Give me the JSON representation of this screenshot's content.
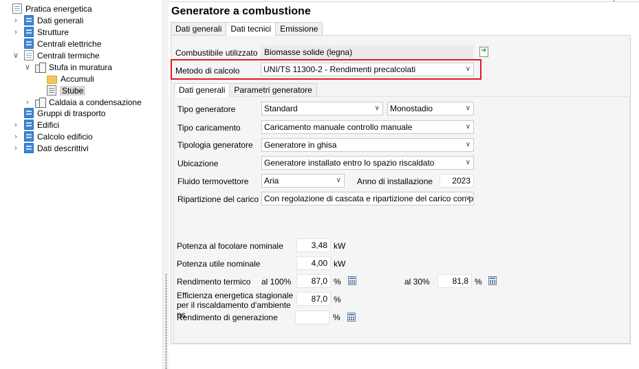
{
  "tree": {
    "items": [
      {
        "label": "Pratica energetica",
        "icon": "document-icon"
      },
      {
        "label": "Dati generali",
        "icon": "blue-sheet-icon"
      },
      {
        "label": "Strutture",
        "icon": "blue-sheet-icon"
      },
      {
        "label": "Centrali elettriche",
        "icon": "blue-sheet-icon"
      },
      {
        "label": "Centrali termiche",
        "icon": "document-icon"
      },
      {
        "label": "Stufa in muratura",
        "icon": "boiler-icon"
      },
      {
        "label": "Accumuli",
        "icon": "folder-icon"
      },
      {
        "label": "Stube",
        "icon": "gray-sheet-icon",
        "selected": true
      },
      {
        "label": "Caldaia a condensazione",
        "icon": "boiler-icon"
      },
      {
        "label": "Gruppi di trasporto",
        "icon": "blue-sheet-icon"
      },
      {
        "label": "Edifici",
        "icon": "blue-sheet-icon"
      },
      {
        "label": "Calcolo edificio",
        "icon": "blue-sheet-icon"
      },
      {
        "label": "Dati descrittivi",
        "icon": "blue-sheet-icon"
      }
    ]
  },
  "main": {
    "title": "Generatore a combustione",
    "tabs": [
      "Dati generali",
      "Dati tecnici",
      "Emissione"
    ],
    "active_tab": "Dati tecnici",
    "combustibile": {
      "label": "Combustibile utilizzato",
      "value": "Biomasse solide (legna)"
    },
    "metodo": {
      "label": "Metodo di calcolo",
      "value": "UNI/TS 11300-2 - Rendimenti precalcolati"
    },
    "subtabs": [
      "Dati generali",
      "Parametri generatore"
    ],
    "active_subtab": "Dati generali",
    "fields": {
      "tipo_generatore": {
        "label": "Tipo generatore",
        "value": "Standard",
        "value2": "Monostadio"
      },
      "tipo_caricamento": {
        "label": "Tipo caricamento",
        "value": "Caricamento manuale controllo manuale"
      },
      "tipologia_generatore": {
        "label": "Tipologia generatore",
        "value": "Generatore in ghisa"
      },
      "ubicazione": {
        "label": "Ubicazione",
        "value": "Generatore installato entro lo spazio riscaldato"
      },
      "fluido": {
        "label": "Fluido termovettore",
        "value": "Aria"
      },
      "anno": {
        "label": "Anno di installazione",
        "value": "2023"
      },
      "ripartizione": {
        "label": "Ripartizione del carico",
        "value": "Con regolazione di cascata e ripartizione del carico con priorità"
      }
    },
    "potenze": {
      "focolare": {
        "label": "Potenza al focolare nominale",
        "value": "3,48",
        "unit": "kW"
      },
      "utile": {
        "label": "Potenza utile nominale",
        "value": "4,00",
        "unit": "kW"
      },
      "rendimento_termico": {
        "label": "Rendimento termico",
        "al100_label": "al 100%",
        "al100_value": "87,0",
        "al30_label": "al 30%",
        "al30_value": "81,8",
        "unit": "%"
      },
      "efficienza": {
        "label": "Efficienza energetica stagionale per il riscaldamento d'ambiente ηs",
        "value": "87,0",
        "unit": "%"
      },
      "rendimento_generazione": {
        "label": "Rendimento di generazione",
        "value": "",
        "unit": "%"
      }
    }
  },
  "colors": {
    "highlight_box": "#e01a22",
    "panel_bg": "#f5f5f5"
  }
}
